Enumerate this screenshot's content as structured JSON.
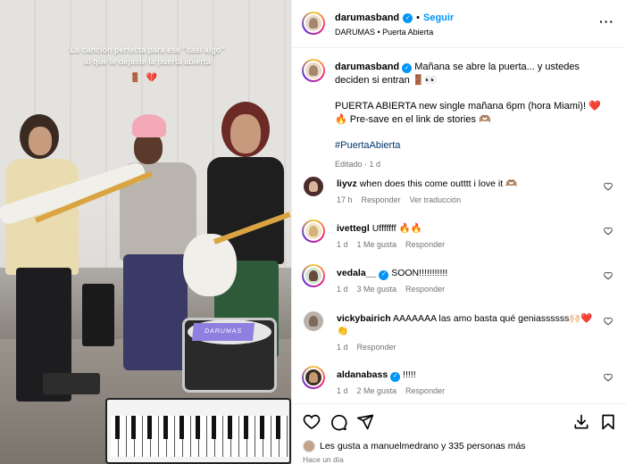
{
  "media": {
    "overlay_caption_line1": "La canción perfecta para ese \"casi algo\"",
    "overlay_caption_line2": "al que le dejaste la puerta abierta",
    "overlay_emoji": "🚪💔",
    "drum_label": "DARUMAS"
  },
  "header": {
    "username": "darumasband",
    "separator": "•",
    "follow_label": "Seguir",
    "subtitle": "DARUMAS • Puerta Abierta",
    "more_icon": "more-horizontal-icon"
  },
  "caption": {
    "username": "darumasband",
    "line1": "Mañana se abre la puerta... y ustedes deciden si entran 🚪👀",
    "line2": "PUERTA ABIERTA new single mañana 6pm (hora Miami)! ❤️🔥 Pre-save en el link de stories 🫶🏽",
    "hashtag": "#PuertaAbierta",
    "edited": "Editado · 1 d"
  },
  "comments": [
    {
      "username": "liyvz",
      "text": "when does this come outttt i love it 🫶🏽",
      "time": "17 h",
      "likes": "",
      "reply": "Responder",
      "translate": "Ver traducción",
      "verified": false
    },
    {
      "username": "ivettegl",
      "text": "Ufffffff 🔥🔥",
      "time": "1 d",
      "likes": "1 Me gusta",
      "reply": "Responder",
      "translate": "",
      "verified": false
    },
    {
      "username": "vedala__",
      "text": "SOON!!!!!!!!!!!",
      "time": "1 d",
      "likes": "3 Me gusta",
      "reply": "Responder",
      "translate": "",
      "verified": true
    },
    {
      "username": "vickybairich",
      "text": "AAAAAAA las amo basta qué geniassssss🙌🏻❤️👏",
      "time": "1 d",
      "likes": "",
      "reply": "Responder",
      "translate": "",
      "verified": false
    },
    {
      "username": "aldanabass",
      "text": "!!!!!",
      "time": "1 d",
      "likes": "2 Me gusta",
      "reply": "Responder",
      "translate": "",
      "verified": true
    }
  ],
  "actions": {
    "likes_text": "Les gusta a manuelmedrano y 335 personas más",
    "likes_user": "manuelmedrano",
    "likes_count": "335",
    "time_ago": "Hace un día"
  },
  "colors": {
    "accent": "#0095f6",
    "muted_text": "#737373",
    "hashtag": "#00376b"
  }
}
